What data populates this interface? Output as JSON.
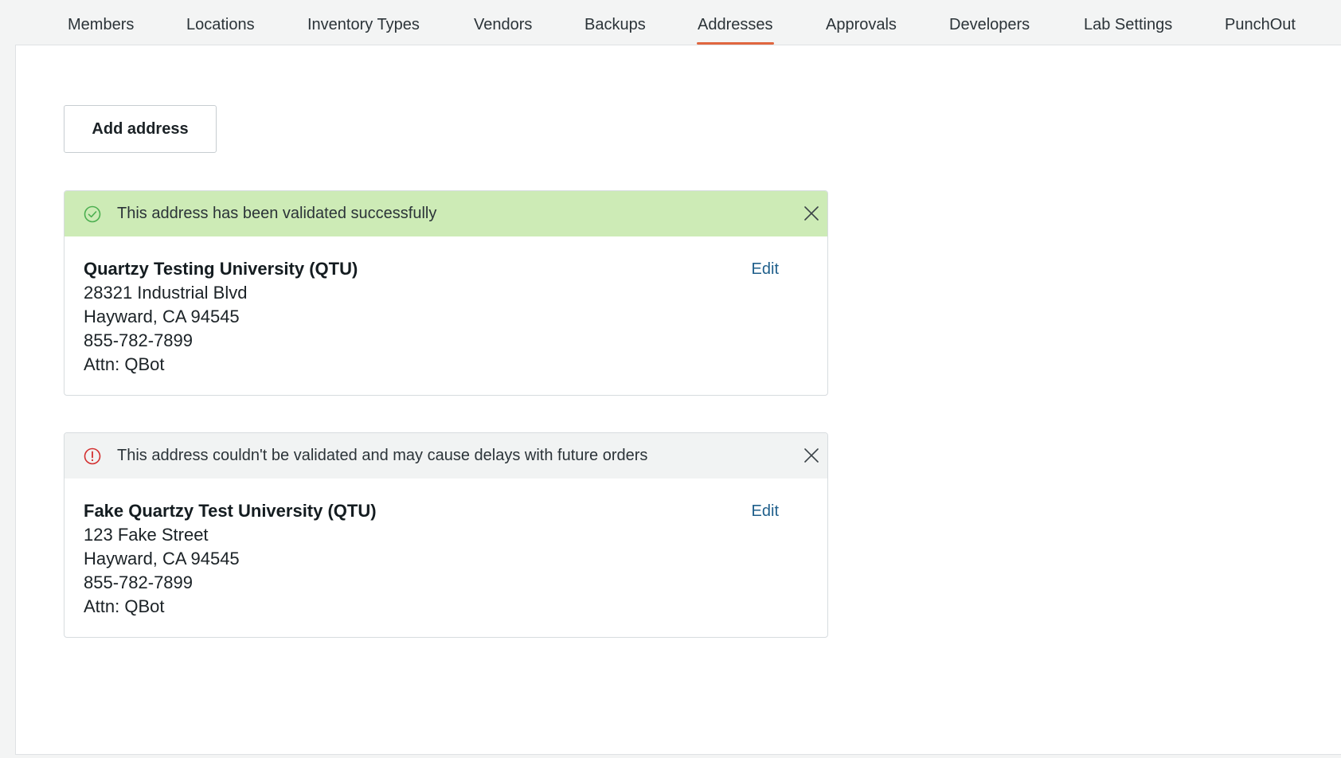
{
  "tabs": [
    {
      "label": "Members"
    },
    {
      "label": "Locations"
    },
    {
      "label": "Inventory Types"
    },
    {
      "label": "Vendors"
    },
    {
      "label": "Backups"
    },
    {
      "label": "Addresses",
      "active": true
    },
    {
      "label": "Approvals"
    },
    {
      "label": "Developers"
    },
    {
      "label": "Lab Settings"
    },
    {
      "label": "PunchOut"
    }
  ],
  "add_address_label": "Add address",
  "addresses": [
    {
      "status": "success",
      "status_icon": "check-circle-icon",
      "banner_text": "This address has been validated successfully",
      "name": "Quartzy Testing University (QTU)",
      "street": "28321 Industrial Blvd",
      "city_line": "Hayward, CA 94545",
      "phone": "855-782-7899",
      "attn": "Attn: QBot",
      "edit_label": "Edit"
    },
    {
      "status": "warning",
      "status_icon": "alert-circle-icon",
      "banner_text": "This address couldn't be validated and may cause delays with future orders",
      "name": "Fake Quartzy Test University (QTU)",
      "street": "123 Fake Street",
      "city_line": "Hayward, CA 94545",
      "phone": "855-782-7899",
      "attn": "Attn: QBot",
      "edit_label": "Edit"
    }
  ],
  "colors": {
    "active_tab_underline": "#e0663f",
    "success_banner": "#cdebb6",
    "success_icon": "#4caf50",
    "warning_icon": "#d32f2f",
    "link": "#1f5f8b"
  }
}
